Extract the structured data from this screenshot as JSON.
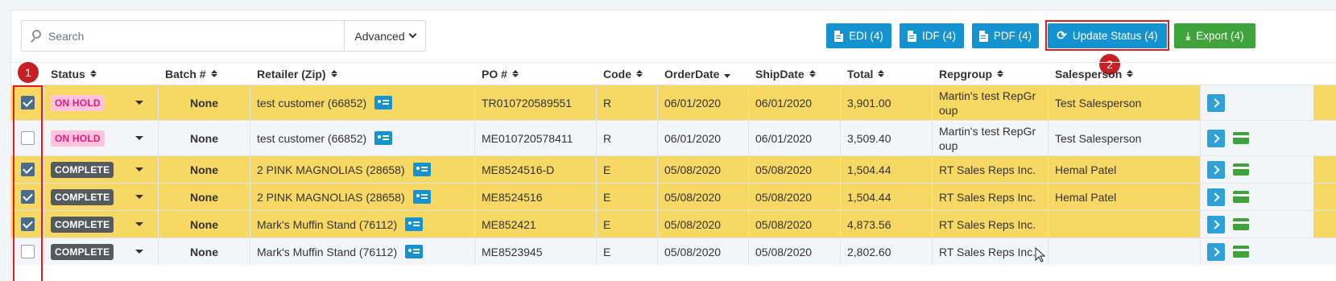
{
  "search": {
    "placeholder": "Search",
    "advanced_label": "Advanced"
  },
  "toolbar": {
    "edi": "EDI (4)",
    "idf": "IDF (4)",
    "pdf": "PDF (4)",
    "update_status": "Update Status (4)",
    "export": "Export (4)"
  },
  "annotations": {
    "one": "1",
    "two": "2"
  },
  "columns": {
    "status": "Status",
    "batch": "Batch #",
    "retailer": "Retailer (Zip)",
    "po": "PO #",
    "code": "Code",
    "order_date": "OrderDate",
    "ship_date": "ShipDate",
    "total": "Total",
    "repgroup": "Repgroup",
    "salesperson": "Salesperson"
  },
  "rows": [
    {
      "checked": true,
      "status": "ON HOLD",
      "batch": "None",
      "retailer": "test customer (66852)",
      "po": "TR010720589551",
      "code": "R",
      "order_date": "06/01/2020",
      "ship_date": "06/01/2020",
      "total": "3,901.00",
      "repgroup": "Martin's test RepGr oup",
      "salesperson": "Test Salesperson"
    },
    {
      "checked": false,
      "status": "ON HOLD",
      "batch": "None",
      "retailer": "test customer (66852)",
      "po": "ME010720578411",
      "code": "R",
      "order_date": "06/01/2020",
      "ship_date": "06/01/2020",
      "total": "3,509.40",
      "repgroup": "Martin's test RepGr oup",
      "salesperson": "Test Salesperson"
    },
    {
      "checked": true,
      "status": "COMPLETE",
      "batch": "None",
      "retailer": "2 PINK MAGNOLIAS (28658)",
      "po": "ME8524516-D",
      "code": "E",
      "order_date": "05/08/2020",
      "ship_date": "05/08/2020",
      "total": "1,504.44",
      "repgroup": "RT Sales Reps Inc.",
      "salesperson": "Hemal Patel"
    },
    {
      "checked": true,
      "status": "COMPLETE",
      "batch": "None",
      "retailer": "2 PINK MAGNOLIAS (28658)",
      "po": "ME8524516",
      "code": "E",
      "order_date": "05/08/2020",
      "ship_date": "05/08/2020",
      "total": "1,504.44",
      "repgroup": "RT Sales Reps Inc.",
      "salesperson": "Hemal Patel"
    },
    {
      "checked": true,
      "status": "COMPLETE",
      "batch": "None",
      "retailer": "Mark's Muffin Stand (76112)",
      "po": "ME852421",
      "code": "E",
      "order_date": "05/08/2020",
      "ship_date": "05/08/2020",
      "total": "4,873.56",
      "repgroup": "RT Sales Reps Inc.",
      "salesperson": ""
    },
    {
      "checked": false,
      "status": "COMPLETE",
      "batch": "None",
      "retailer": "Mark's Muffin Stand (76112)",
      "po": "ME8523945",
      "code": "E",
      "order_date": "05/08/2020",
      "ship_date": "05/08/2020",
      "total": "2,802.60",
      "repgroup": "RT Sales Reps Inc.",
      "salesperson": ""
    }
  ],
  "colors": {
    "accent_blue": "#1593d1",
    "export_green": "#3ea33a",
    "selected_row": "#f7d862",
    "annotation_red": "#e11d1d"
  },
  "icons": [
    "search-icon",
    "chevron-down-icon",
    "document-icon",
    "refresh-icon",
    "download-icon",
    "sort-icon",
    "customer-card-icon",
    "chevron-right-icon",
    "credit-card-icon"
  ]
}
